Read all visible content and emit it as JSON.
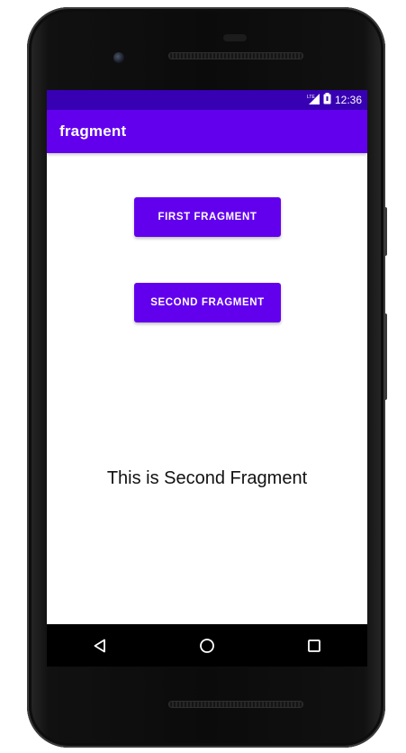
{
  "status_bar": {
    "time": "12:36",
    "signal_icon": "cell-signal-icon",
    "battery_icon": "battery-icon"
  },
  "app_bar": {
    "title": "fragment"
  },
  "buttons": {
    "first": "FIRST FRAGMENT",
    "second": "SECOND FRAGMENT"
  },
  "content": {
    "text": "This is Second Fragment"
  },
  "nav_bar": {
    "back_icon": "back-triangle-icon",
    "home_icon": "home-circle-icon",
    "recents_icon": "recents-square-icon"
  },
  "colors": {
    "status_bar": "#3700b3",
    "primary": "#6200ee",
    "nav_bar": "#000000"
  }
}
